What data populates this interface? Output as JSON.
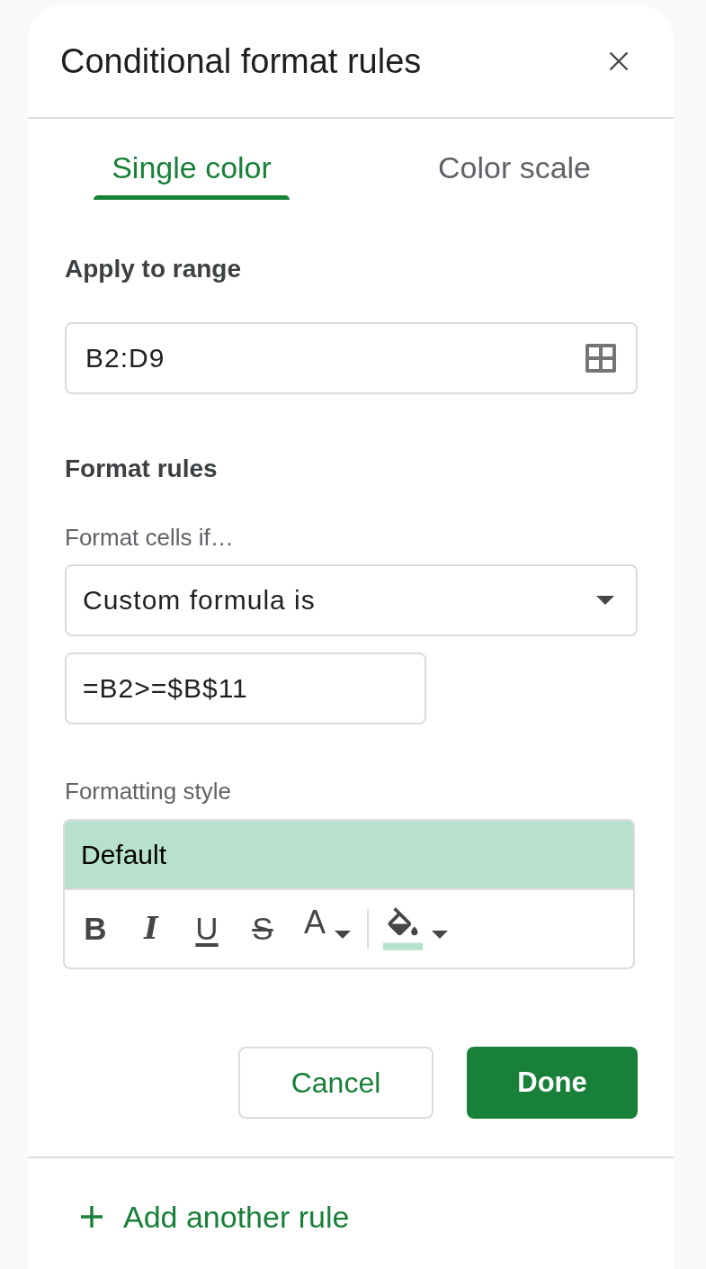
{
  "panel": {
    "title": "Conditional format rules"
  },
  "tabs": [
    {
      "label": "Single color",
      "selected": true
    },
    {
      "label": "Color scale",
      "selected": false
    }
  ],
  "apply_to_range": {
    "heading": "Apply to range",
    "value": "B2:D9"
  },
  "format_rules": {
    "heading": "Format rules",
    "condition_label": "Format cells if…",
    "condition": "Custom formula is",
    "formula": "=B2>=$B$11"
  },
  "formatting_style": {
    "label": "Formatting style",
    "preview": "Default",
    "toolbar": [
      {
        "kind": "bold",
        "label": "B"
      },
      {
        "kind": "italic",
        "label": "I"
      },
      {
        "kind": "underline",
        "label": "U"
      },
      {
        "kind": "strikethrough",
        "label": "S"
      },
      {
        "kind": "text_color",
        "label": "A"
      },
      {
        "kind": "fill_color"
      }
    ]
  },
  "buttons": [
    {
      "kind": "secondary",
      "label": "Cancel"
    },
    {
      "kind": "primary",
      "label": "Done"
    }
  ],
  "add_rule": {
    "label": "Add another rule"
  }
}
